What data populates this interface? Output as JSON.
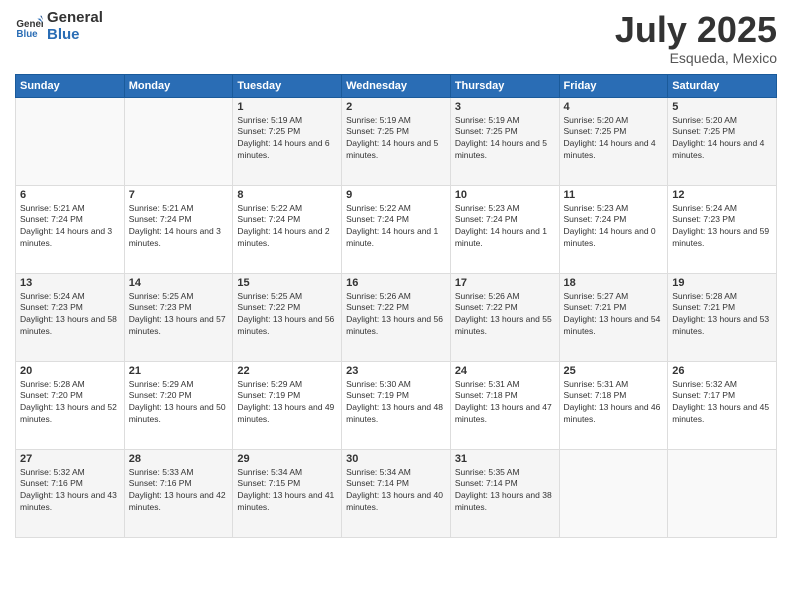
{
  "logo": {
    "general": "General",
    "blue": "Blue"
  },
  "title": {
    "month_year": "July 2025",
    "location": "Esqueda, Mexico"
  },
  "weekdays": [
    "Sunday",
    "Monday",
    "Tuesday",
    "Wednesday",
    "Thursday",
    "Friday",
    "Saturday"
  ],
  "weeks": [
    [
      {
        "day": "",
        "info": ""
      },
      {
        "day": "",
        "info": ""
      },
      {
        "day": "1",
        "info": "Sunrise: 5:19 AM\nSunset: 7:25 PM\nDaylight: 14 hours and 6 minutes."
      },
      {
        "day": "2",
        "info": "Sunrise: 5:19 AM\nSunset: 7:25 PM\nDaylight: 14 hours and 5 minutes."
      },
      {
        "day": "3",
        "info": "Sunrise: 5:19 AM\nSunset: 7:25 PM\nDaylight: 14 hours and 5 minutes."
      },
      {
        "day": "4",
        "info": "Sunrise: 5:20 AM\nSunset: 7:25 PM\nDaylight: 14 hours and 4 minutes."
      },
      {
        "day": "5",
        "info": "Sunrise: 5:20 AM\nSunset: 7:25 PM\nDaylight: 14 hours and 4 minutes."
      }
    ],
    [
      {
        "day": "6",
        "info": "Sunrise: 5:21 AM\nSunset: 7:24 PM\nDaylight: 14 hours and 3 minutes."
      },
      {
        "day": "7",
        "info": "Sunrise: 5:21 AM\nSunset: 7:24 PM\nDaylight: 14 hours and 3 minutes."
      },
      {
        "day": "8",
        "info": "Sunrise: 5:22 AM\nSunset: 7:24 PM\nDaylight: 14 hours and 2 minutes."
      },
      {
        "day": "9",
        "info": "Sunrise: 5:22 AM\nSunset: 7:24 PM\nDaylight: 14 hours and 1 minute."
      },
      {
        "day": "10",
        "info": "Sunrise: 5:23 AM\nSunset: 7:24 PM\nDaylight: 14 hours and 1 minute."
      },
      {
        "day": "11",
        "info": "Sunrise: 5:23 AM\nSunset: 7:24 PM\nDaylight: 14 hours and 0 minutes."
      },
      {
        "day": "12",
        "info": "Sunrise: 5:24 AM\nSunset: 7:23 PM\nDaylight: 13 hours and 59 minutes."
      }
    ],
    [
      {
        "day": "13",
        "info": "Sunrise: 5:24 AM\nSunset: 7:23 PM\nDaylight: 13 hours and 58 minutes."
      },
      {
        "day": "14",
        "info": "Sunrise: 5:25 AM\nSunset: 7:23 PM\nDaylight: 13 hours and 57 minutes."
      },
      {
        "day": "15",
        "info": "Sunrise: 5:25 AM\nSunset: 7:22 PM\nDaylight: 13 hours and 56 minutes."
      },
      {
        "day": "16",
        "info": "Sunrise: 5:26 AM\nSunset: 7:22 PM\nDaylight: 13 hours and 56 minutes."
      },
      {
        "day": "17",
        "info": "Sunrise: 5:26 AM\nSunset: 7:22 PM\nDaylight: 13 hours and 55 minutes."
      },
      {
        "day": "18",
        "info": "Sunrise: 5:27 AM\nSunset: 7:21 PM\nDaylight: 13 hours and 54 minutes."
      },
      {
        "day": "19",
        "info": "Sunrise: 5:28 AM\nSunset: 7:21 PM\nDaylight: 13 hours and 53 minutes."
      }
    ],
    [
      {
        "day": "20",
        "info": "Sunrise: 5:28 AM\nSunset: 7:20 PM\nDaylight: 13 hours and 52 minutes."
      },
      {
        "day": "21",
        "info": "Sunrise: 5:29 AM\nSunset: 7:20 PM\nDaylight: 13 hours and 50 minutes."
      },
      {
        "day": "22",
        "info": "Sunrise: 5:29 AM\nSunset: 7:19 PM\nDaylight: 13 hours and 49 minutes."
      },
      {
        "day": "23",
        "info": "Sunrise: 5:30 AM\nSunset: 7:19 PM\nDaylight: 13 hours and 48 minutes."
      },
      {
        "day": "24",
        "info": "Sunrise: 5:31 AM\nSunset: 7:18 PM\nDaylight: 13 hours and 47 minutes."
      },
      {
        "day": "25",
        "info": "Sunrise: 5:31 AM\nSunset: 7:18 PM\nDaylight: 13 hours and 46 minutes."
      },
      {
        "day": "26",
        "info": "Sunrise: 5:32 AM\nSunset: 7:17 PM\nDaylight: 13 hours and 45 minutes."
      }
    ],
    [
      {
        "day": "27",
        "info": "Sunrise: 5:32 AM\nSunset: 7:16 PM\nDaylight: 13 hours and 43 minutes."
      },
      {
        "day": "28",
        "info": "Sunrise: 5:33 AM\nSunset: 7:16 PM\nDaylight: 13 hours and 42 minutes."
      },
      {
        "day": "29",
        "info": "Sunrise: 5:34 AM\nSunset: 7:15 PM\nDaylight: 13 hours and 41 minutes."
      },
      {
        "day": "30",
        "info": "Sunrise: 5:34 AM\nSunset: 7:14 PM\nDaylight: 13 hours and 40 minutes."
      },
      {
        "day": "31",
        "info": "Sunrise: 5:35 AM\nSunset: 7:14 PM\nDaylight: 13 hours and 38 minutes."
      },
      {
        "day": "",
        "info": ""
      },
      {
        "day": "",
        "info": ""
      }
    ]
  ]
}
